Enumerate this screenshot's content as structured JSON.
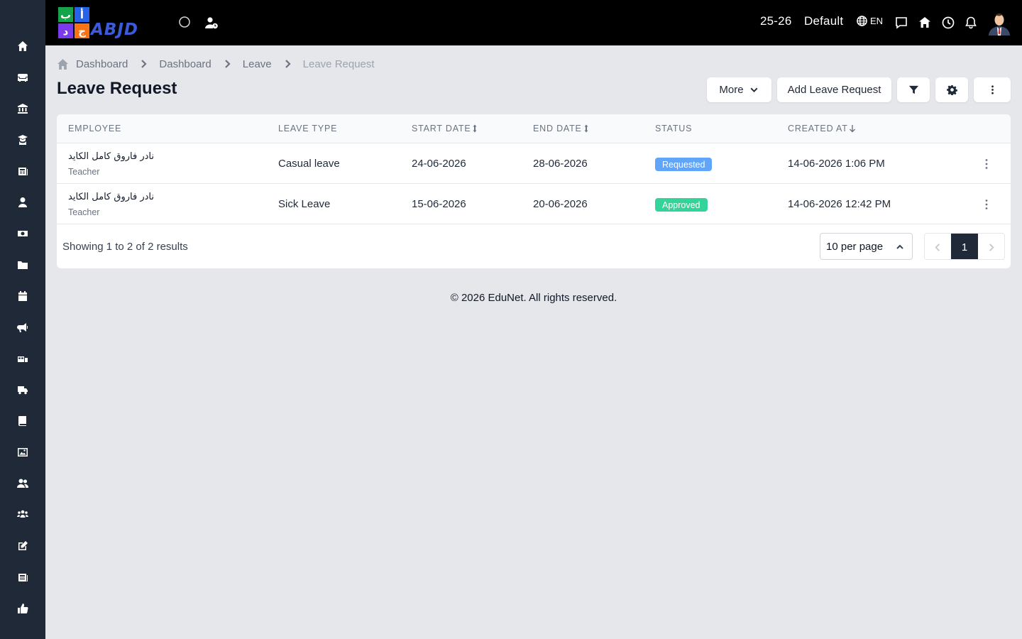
{
  "topbar": {
    "session": "25-26",
    "profile": "Default",
    "language": "EN",
    "logo_word": "ABJD",
    "logo_letters": [
      "ب",
      "أ",
      "د",
      "ج"
    ]
  },
  "sidebar": {
    "items": [
      "home-icon",
      "sofa-icon",
      "bank-icon",
      "graduate-icon",
      "newspaper-icon",
      "user-tie-icon",
      "money-icon",
      "folder-icon",
      "calendar-icon",
      "megaphone-icon",
      "bus-school-icon",
      "truck-icon",
      "book-icon",
      "image-icon",
      "users-icon",
      "group-icon",
      "edit-icon",
      "news-icon",
      "thumbs-up-icon"
    ]
  },
  "breadcrumb": {
    "items": [
      "Dashboard",
      "Dashboard",
      "Leave",
      "Leave Request"
    ]
  },
  "page": {
    "title": "Leave Request"
  },
  "actions": {
    "more_label": "More",
    "add_label": "Add Leave Request"
  },
  "table": {
    "headers": {
      "employee": "EMPLOYEE",
      "leave_type": "LEAVE TYPE",
      "start_date": "START DATE",
      "end_date": "END DATE",
      "status": "STATUS",
      "created_at": "CREATED AT"
    },
    "rows": [
      {
        "employee": "نادر فاروق كامل الكايد",
        "role": "Teacher",
        "leave_type": "Casual leave",
        "start_date": "24-06-2026",
        "end_date": "28-06-2026",
        "status": "Requested",
        "status_color": "#60a5fa",
        "created_at": "14-06-2026 1:06 PM"
      },
      {
        "employee": "نادر فاروق كامل الكايد",
        "role": "Teacher",
        "leave_type": "Sick Leave",
        "start_date": "15-06-2026",
        "end_date": "20-06-2026",
        "status": "Approved",
        "status_color": "#34d399",
        "created_at": "14-06-2026 12:42 PM"
      }
    ]
  },
  "pagination": {
    "showing": "Showing 1 to 2 of 2 results",
    "per_page": "10 per page",
    "current_page": "1"
  },
  "footer": {
    "text": "© 2026 EduNet. All rights reserved."
  },
  "colors": {
    "sidebar_bg": "#1f2937",
    "topbar_bg": "#000000",
    "page_bg": "#e5e7eb",
    "requested": "#60a5fa",
    "approved": "#34d399"
  }
}
